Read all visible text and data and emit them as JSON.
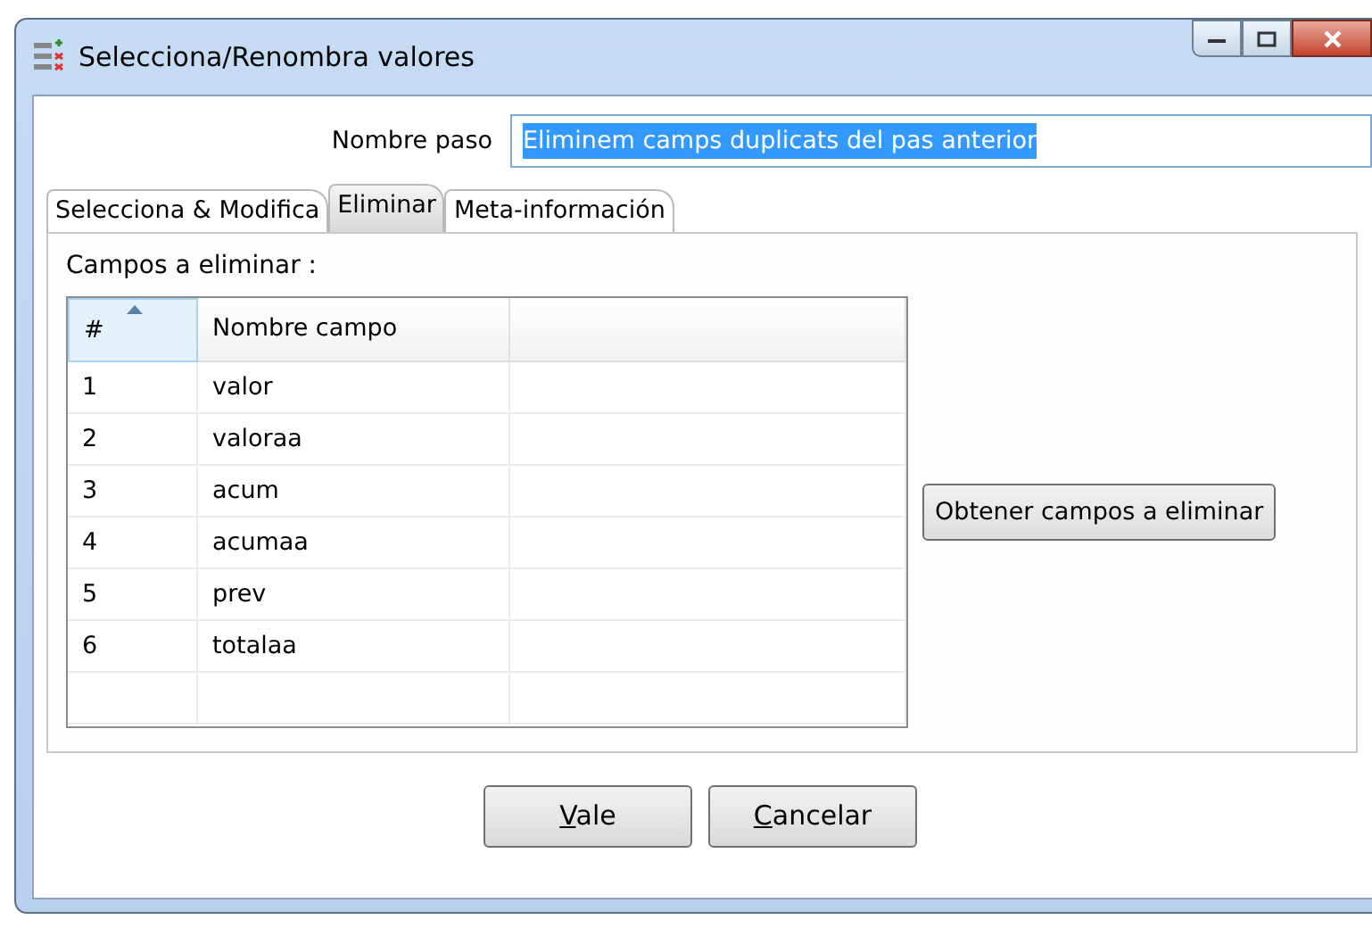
{
  "window": {
    "title": "Selecciona/Renombra valores"
  },
  "step_name": {
    "label": "Nombre paso",
    "value": "Eliminem camps duplicats del pas anterior",
    "selected": true
  },
  "tabs": [
    {
      "label": "Selecciona & Modifica",
      "selected": false
    },
    {
      "label": "Eliminar",
      "selected": true
    },
    {
      "label": "Meta-información",
      "selected": false
    }
  ],
  "panel": {
    "label": "Campos a eliminar :",
    "table": {
      "columns": [
        {
          "label": "#",
          "sorted": true
        },
        {
          "label": "Nombre campo",
          "sorted": false
        }
      ],
      "rows": [
        [
          "1",
          "valor"
        ],
        [
          "2",
          "valoraa"
        ],
        [
          "3",
          "acum"
        ],
        [
          "4",
          "acumaa"
        ],
        [
          "5",
          "prev"
        ],
        [
          "6",
          "totalaa"
        ]
      ]
    },
    "get_button": "Obtener campos a eliminar"
  },
  "buttons": [
    {
      "label": "Vale",
      "mnemonic": true
    },
    {
      "label": "Cancelar",
      "mnemonic": true
    }
  ]
}
